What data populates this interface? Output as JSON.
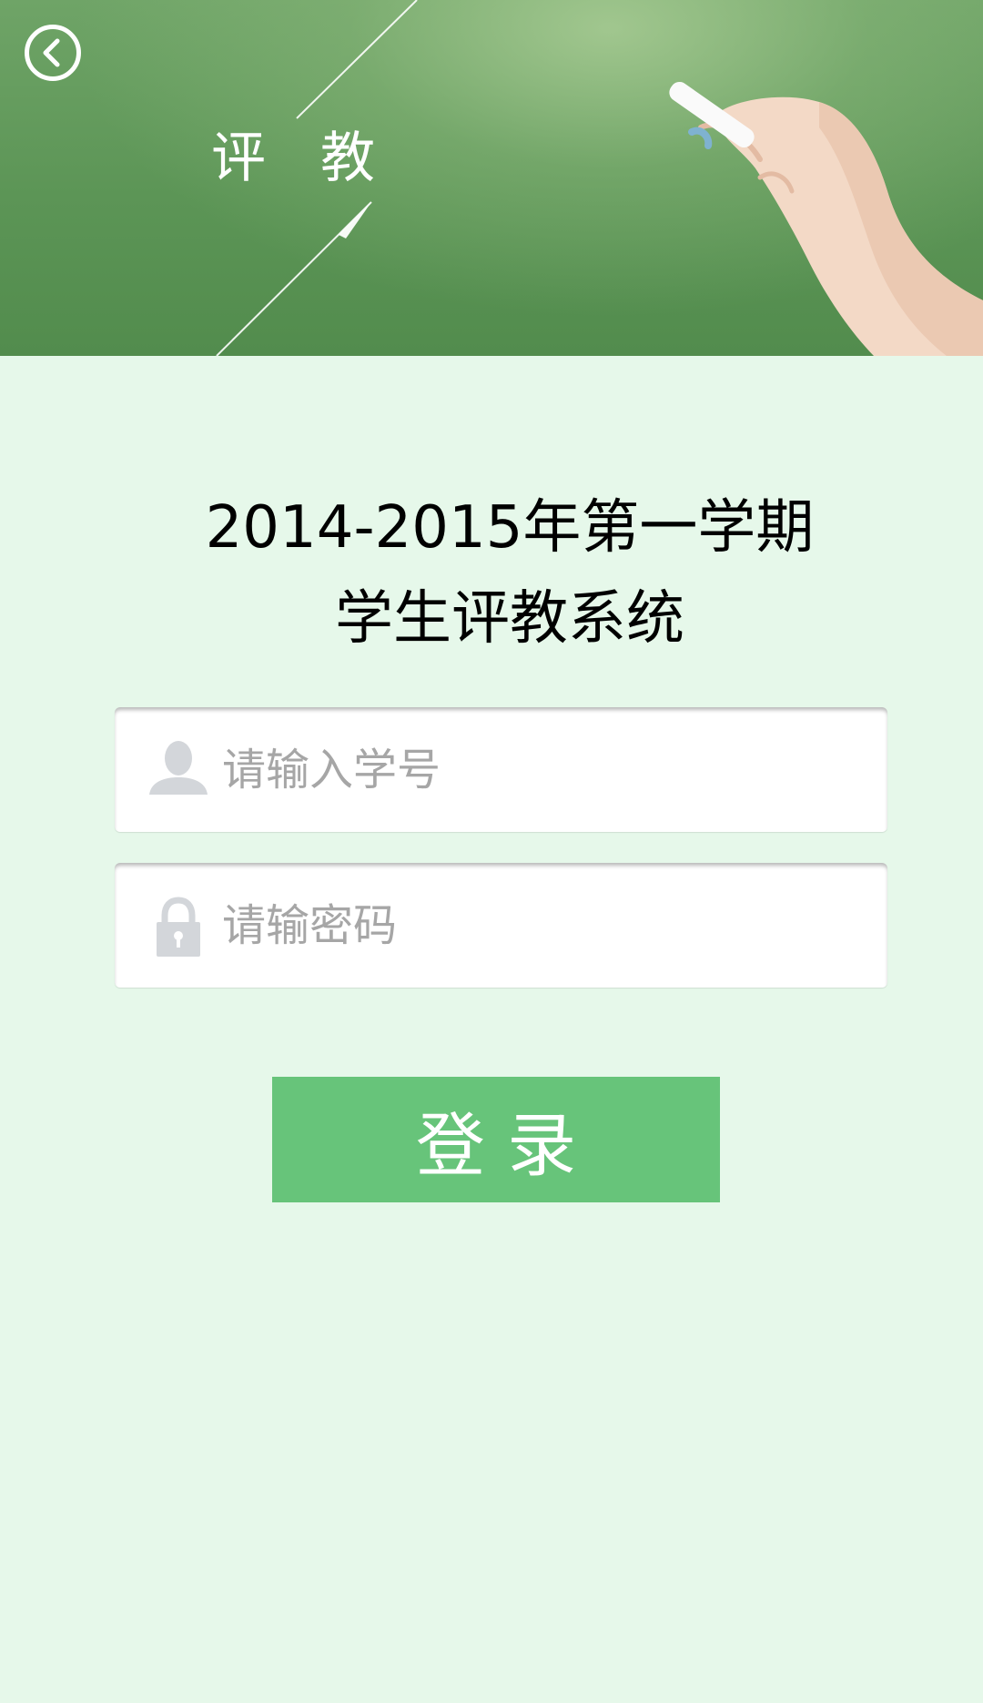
{
  "header": {
    "title": "评　教",
    "back_icon": "back-arrow-icon"
  },
  "heading": {
    "line1": "2014-2015年第一学期",
    "line2": "学生评教系统"
  },
  "form": {
    "student_id": {
      "value": "",
      "placeholder": "请输入学号",
      "icon": "user-icon"
    },
    "password": {
      "value": "",
      "placeholder": "请输密码",
      "icon": "lock-icon"
    },
    "login_label": "登 录"
  },
  "colors": {
    "background": "#e6f8ea",
    "button": "#67c47a",
    "banner": "#5c9556",
    "placeholder": "#a6a6a6",
    "icon": "#d3d6da"
  }
}
